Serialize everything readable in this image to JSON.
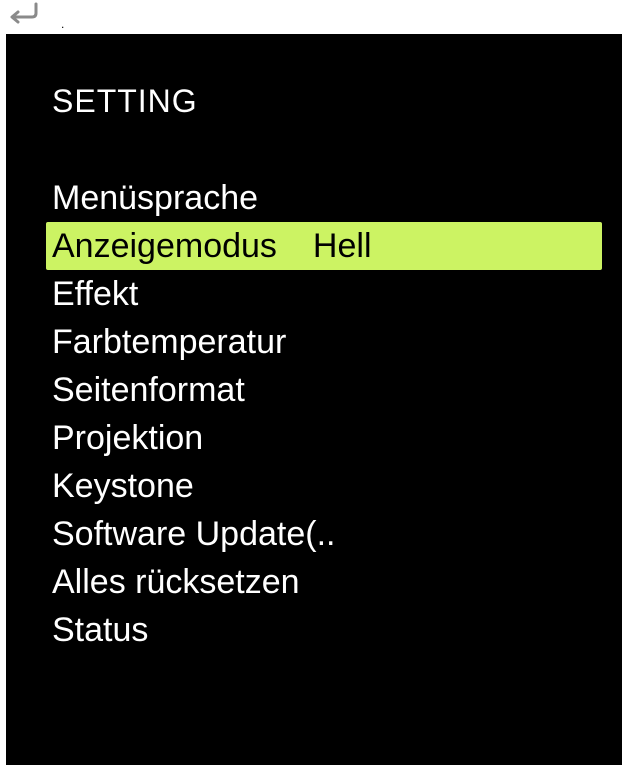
{
  "colors": {
    "screen_background": "#000000",
    "text": "#ffffff",
    "highlight": "#ccf363",
    "highlight_text": "#000000"
  },
  "topbar": {
    "back_icon": "return-arrow-icon",
    "dot": "."
  },
  "menu": {
    "title": "SETTING",
    "items": [
      {
        "label": "Menüsprache",
        "value": ""
      },
      {
        "label": "Anzeigemodus",
        "value": "Hell",
        "selected": true
      },
      {
        "label": "Effekt",
        "value": ""
      },
      {
        "label": "Farbtemperatur",
        "value": ""
      },
      {
        "label": "Seitenformat",
        "value": ""
      },
      {
        "label": "Projektion",
        "value": ""
      },
      {
        "label": "Keystone",
        "value": ""
      },
      {
        "label": "Software Update(..",
        "value": ""
      },
      {
        "label": "Alles rücksetzen",
        "value": ""
      },
      {
        "label": "Status",
        "value": ""
      }
    ]
  }
}
